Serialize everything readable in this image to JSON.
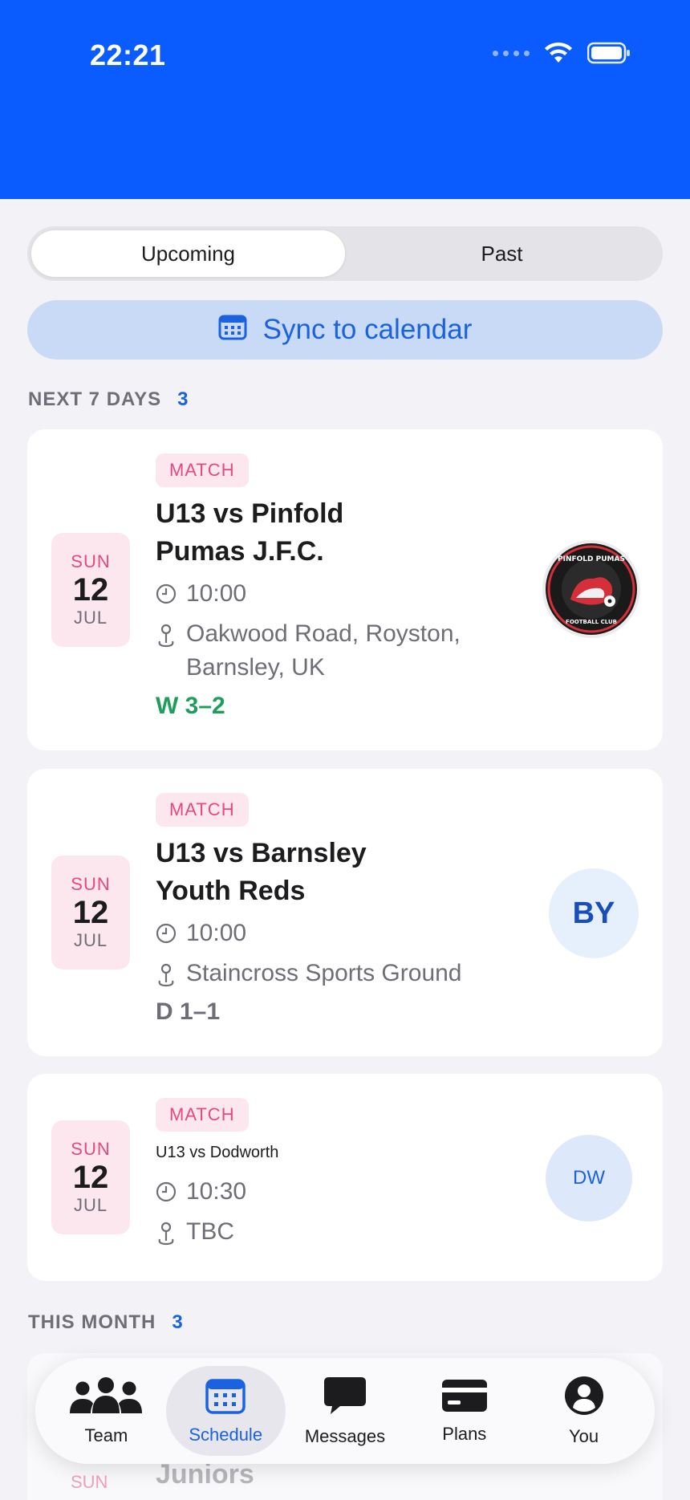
{
  "status_bar": {
    "time": "22:21"
  },
  "segments": [
    {
      "label": "Upcoming",
      "active": true
    },
    {
      "label": "Past",
      "active": false
    }
  ],
  "sync_label": "Sync to calendar",
  "sections": [
    {
      "title": "NEXT 7 DAYS",
      "count": "3"
    },
    {
      "title": "THIS MONTH",
      "count": "3"
    }
  ],
  "events": [
    {
      "dow": "SUN",
      "day": "12",
      "month": "JUL",
      "tag": "MATCH",
      "title_lines": [
        "U13 vs Pinfold",
        "Pumas J.F.C."
      ],
      "time": "10:00",
      "location_lines": [
        "Oakwood Road, Royston,",
        "Barnsley, UK"
      ],
      "result": "W 3–2",
      "crest_text": [
        "PINFOLD PUMAS",
        "FOOTBALL CLUB"
      ]
    },
    {
      "dow": "SUN",
      "day": "12",
      "month": "JUL",
      "tag": "MATCH",
      "title_lines": [
        "U13 vs Barnsley",
        "Youth Reds"
      ],
      "time": "10:00",
      "location_lines": [
        "Staincross Sports Ground"
      ],
      "result": "D 1–1",
      "avatar": "BY"
    },
    {
      "dow": "SUN",
      "day": "12",
      "month": "JUL",
      "tag": "MATCH",
      "title_lines": [
        "U13 vs Dodworth"
      ],
      "time": "10:30",
      "location_lines": [
        "TBC"
      ],
      "avatar": "DW"
    }
  ],
  "peek": {
    "title": "Juniors",
    "dow": "SUN"
  },
  "tabs": [
    {
      "label": "Team",
      "icon": "team-icon",
      "active": false
    },
    {
      "label": "Schedule",
      "icon": "calendar-icon",
      "active": true
    },
    {
      "label": "Messages",
      "icon": "message-icon",
      "active": false
    },
    {
      "label": "Plans",
      "icon": "card-icon",
      "active": false
    },
    {
      "label": "You",
      "icon": "person-icon",
      "active": false
    }
  ],
  "colors": {
    "brand": "#0a5cff",
    "accent": "#1a62e0",
    "pink": "#e64980",
    "win": "#1e9e5a"
  }
}
